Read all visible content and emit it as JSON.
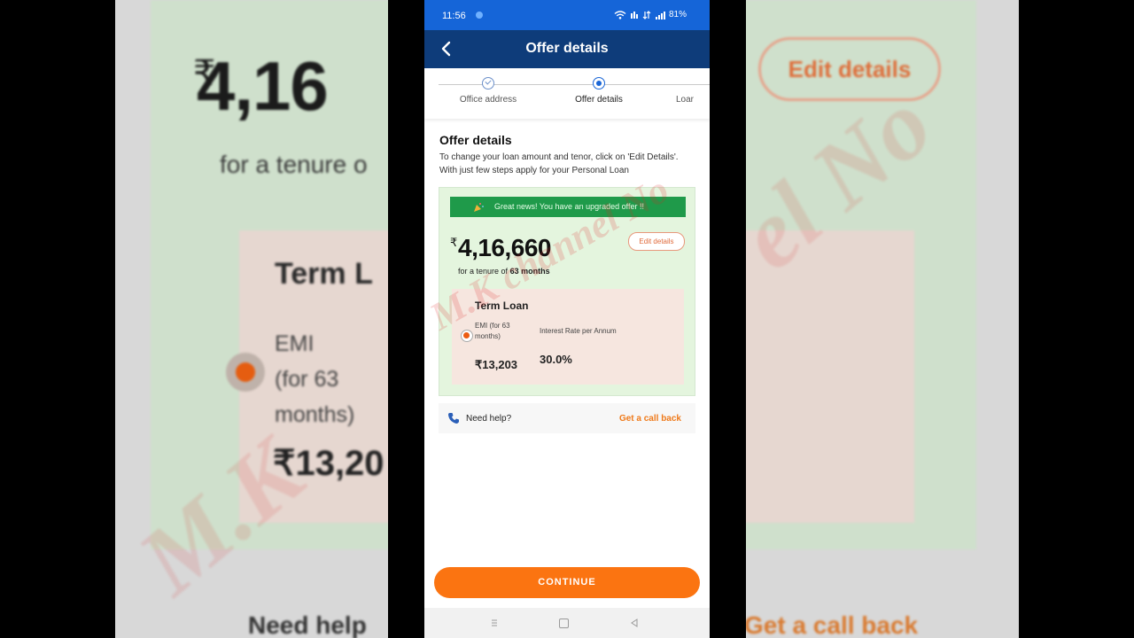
{
  "status_bar": {
    "time": "11:56",
    "battery": "81%"
  },
  "header": {
    "title": "Offer details"
  },
  "stepper": {
    "steps": [
      {
        "label": "Office address",
        "state": "completed"
      },
      {
        "label": "Offer details",
        "state": "active"
      },
      {
        "label": "Loar",
        "state": "pending"
      }
    ]
  },
  "section": {
    "title": "Offer details",
    "description": "To change your loan amount and tenor, click on 'Edit Details'. With just few steps apply for your Personal Loan"
  },
  "offer": {
    "banner": "Great news! You have an upgraded offer !!",
    "currency": "₹",
    "amount": "4,16,660",
    "tenure_prefix": "for a tenure of",
    "tenure_value": "63 months",
    "edit_label": "Edit details"
  },
  "term_loan": {
    "title": "Term Loan",
    "emi_label": "EMI (for 63 months)",
    "emi_value": "₹13,203",
    "rate_label": "Interest Rate per Annum",
    "rate_value": "30.0%",
    "selected": true
  },
  "help": {
    "label": "Need help?",
    "callback_label": "Get a call back"
  },
  "continue_label": "CONTINUE",
  "watermark": "M.K channel No",
  "background": {
    "currency": "₹",
    "amount": "4,16",
    "tenure": "for a tenure o",
    "term": "Term L",
    "emi_line1": "EMI",
    "emi_line2": "(for 63",
    "emi_line3": "months)",
    "emi_value": "₹13,20",
    "need_help": "Need help",
    "edit": "Edit details",
    "callback": "Get a call back",
    "watermark_left": "M.K",
    "watermark_right": "el No"
  },
  "colors": {
    "status_bar": "#1565d8",
    "header": "#0e3c7a",
    "accent": "#fb7411",
    "banner": "#1f9a4a",
    "offer_card": "#e4f5de",
    "term_card": "#f6e6df"
  }
}
